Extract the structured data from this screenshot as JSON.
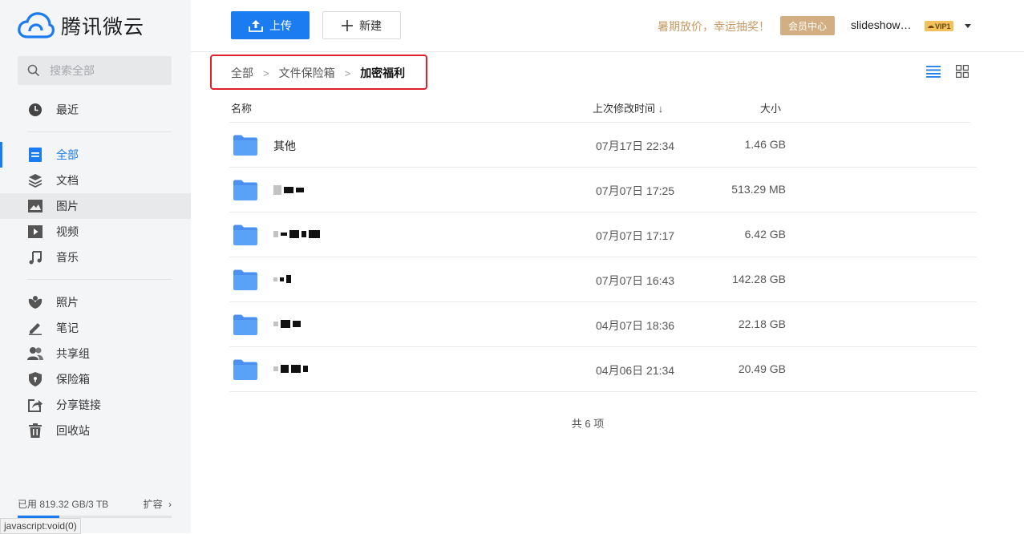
{
  "app": {
    "name": "腾讯微云"
  },
  "search": {
    "placeholder": "搜索全部"
  },
  "sidebar": {
    "items": [
      {
        "label": "最近"
      },
      {
        "label": "全部"
      },
      {
        "label": "文档"
      },
      {
        "label": "图片"
      },
      {
        "label": "视频"
      },
      {
        "label": "音乐"
      },
      {
        "label": "照片"
      },
      {
        "label": "笔记"
      },
      {
        "label": "共享组"
      },
      {
        "label": "保险箱"
      },
      {
        "label": "分享链接"
      },
      {
        "label": "回收站"
      }
    ],
    "storage_used": "已用 819.32 GB/3 TB",
    "expand_label": "扩容",
    "storage_fraction": 0.27
  },
  "toolbar": {
    "upload_label": "上传",
    "new_label": "新建"
  },
  "header": {
    "promo": "暑期放价，幸运抽奖！",
    "vip_center": "会员中心",
    "username": "slideshow…",
    "vip_badge": "VIP1"
  },
  "breadcrumb": [
    "全部",
    "文件保险箱",
    "加密福利"
  ],
  "table": {
    "columns": {
      "name": "名称",
      "modified": "上次修改时间",
      "size": "大小"
    },
    "rows": [
      {
        "name": "其他",
        "modified": "07月17日 22:34",
        "size": "1.46 GB"
      },
      {
        "name": "",
        "modified": "07月07日 17:25",
        "size": "513.29 MB"
      },
      {
        "name": "",
        "modified": "07月07日 17:17",
        "size": "6.42 GB"
      },
      {
        "name": "",
        "modified": "07月07日 16:43",
        "size": "142.28 GB"
      },
      {
        "name": "",
        "modified": "04月07日 18:36",
        "size": "22.18 GB"
      },
      {
        "name": "",
        "modified": "04月06日 21:34",
        "size": "20.49 GB"
      }
    ]
  },
  "footer": {
    "total": "共 6 项"
  },
  "status_bar": {
    "text": "javascript:void(0)"
  },
  "colors": {
    "accent": "#1b7bf0",
    "promo": "#c79a63",
    "vip_center": "#d3ae82",
    "highlight_box": "#e0202b"
  }
}
